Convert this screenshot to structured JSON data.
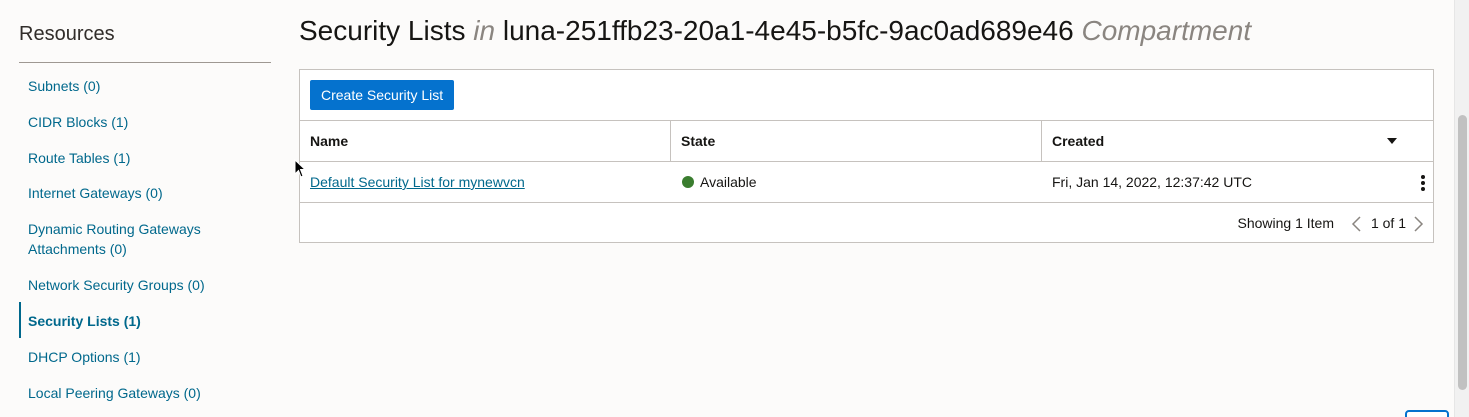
{
  "sidebar": {
    "title": "Resources",
    "items": [
      {
        "label": "Subnets (0)",
        "active": false
      },
      {
        "label": "CIDR Blocks (1)",
        "active": false
      },
      {
        "label": "Route Tables (1)",
        "active": false
      },
      {
        "label": "Internet Gateways (0)",
        "active": false
      },
      {
        "label": "Dynamic Routing Gateways Attachments (0)",
        "active": false
      },
      {
        "label": "Network Security Groups (0)",
        "active": false
      },
      {
        "label": "Security Lists (1)",
        "active": true
      },
      {
        "label": "DHCP Options (1)",
        "active": false
      },
      {
        "label": "Local Peering Gateways (0)",
        "active": false
      }
    ]
  },
  "header": {
    "title": "Security Lists",
    "in_word": "in",
    "compartment_name": "luna-251ffb23-20a1-4e45-b5fc-9ac0ad689e46",
    "compartment_word": "Compartment"
  },
  "toolbar": {
    "create_label": "Create Security List"
  },
  "table": {
    "columns": [
      "Name",
      "State",
      "Created"
    ],
    "rows": [
      {
        "name": "Default Security List for mynewvcn",
        "state": "Available",
        "created": "Fri, Jan 14, 2022, 12:37:42 UTC"
      }
    ]
  },
  "pagination": {
    "showing": "Showing 1 Item",
    "page": "1 of 1"
  },
  "colors": {
    "primary": "#0572ce",
    "link": "#00688c",
    "available": "#3a7d2f"
  }
}
